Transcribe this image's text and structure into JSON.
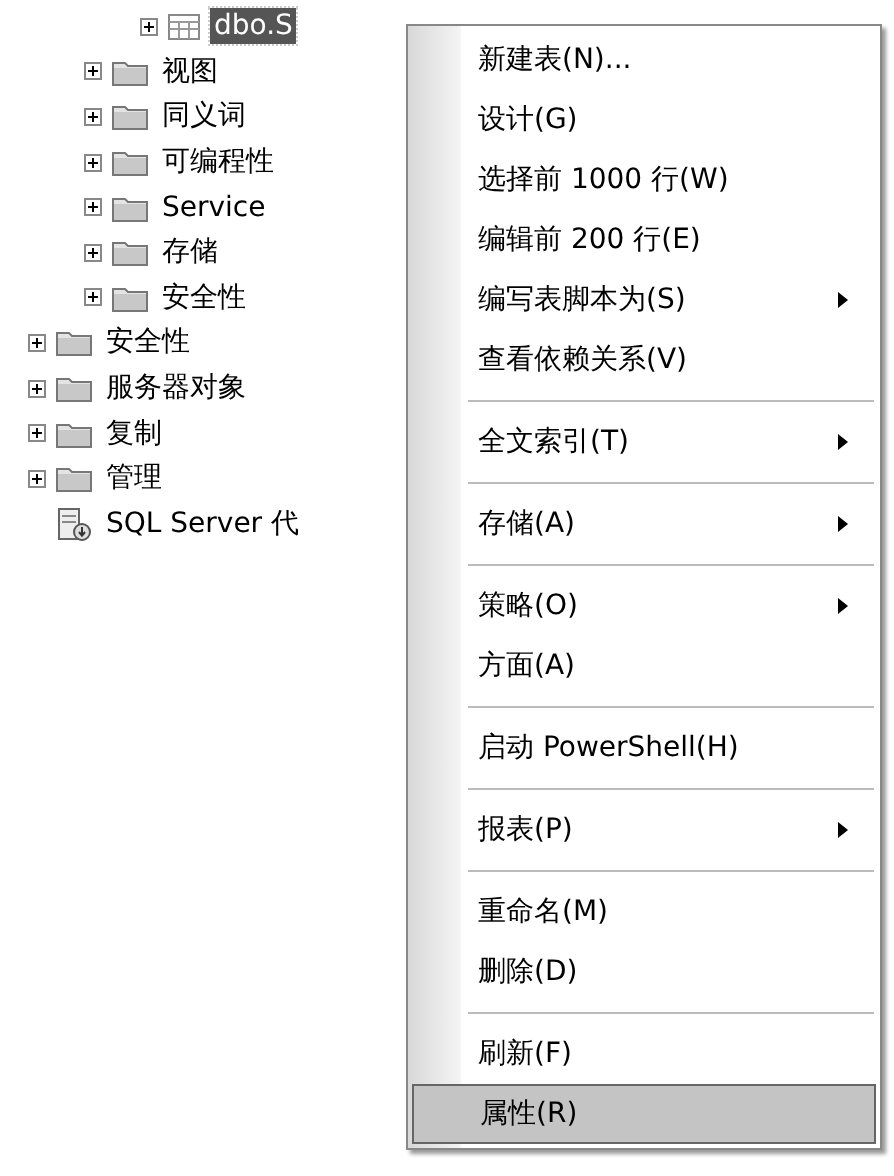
{
  "tree": {
    "children": [
      {
        "children": [
          {
            "children": [
              {
                "label": "dbo.S",
                "kind": "table",
                "expandable": true,
                "selected": true
              }
            ]
          },
          {
            "label": "视图",
            "kind": "folder",
            "expandable": true,
            "selected": false
          },
          {
            "label": "同义词",
            "kind": "folder",
            "expandable": true,
            "selected": false
          },
          {
            "label": "可编程性",
            "kind": "folder",
            "expandable": true,
            "selected": false
          },
          {
            "label": "Service",
            "kind": "folder",
            "expandable": true,
            "selected": false
          },
          {
            "label": "存储",
            "kind": "folder",
            "expandable": true,
            "selected": false
          },
          {
            "label": "安全性",
            "kind": "folder",
            "expandable": true,
            "selected": false
          }
        ]
      },
      {
        "label": "安全性",
        "kind": "folder",
        "expandable": true,
        "selected": false
      },
      {
        "label": "服务器对象",
        "kind": "folder",
        "expandable": true,
        "selected": false
      },
      {
        "label": "复制",
        "kind": "folder",
        "expandable": true,
        "selected": false
      },
      {
        "label": "管理",
        "kind": "folder",
        "expandable": true,
        "selected": false
      },
      {
        "label": "SQL Server 代",
        "kind": "agent",
        "expandable": false,
        "selected": false
      }
    ]
  },
  "context_menu": {
    "items": [
      {
        "kind": "item",
        "label": "新建表(N)...",
        "submenu": false,
        "selected": false
      },
      {
        "kind": "item",
        "label": "设计(G)",
        "submenu": false,
        "selected": false
      },
      {
        "kind": "item",
        "label": "选择前 1000 行(W)",
        "submenu": false,
        "selected": false
      },
      {
        "kind": "item",
        "label": "编辑前 200 行(E)",
        "submenu": false,
        "selected": false
      },
      {
        "kind": "item",
        "label": "编写表脚本为(S)",
        "submenu": true,
        "selected": false
      },
      {
        "kind": "item",
        "label": "查看依赖关系(V)",
        "submenu": false,
        "selected": false
      },
      {
        "kind": "separator"
      },
      {
        "kind": "item",
        "label": "全文索引(T)",
        "submenu": true,
        "selected": false
      },
      {
        "kind": "separator"
      },
      {
        "kind": "item",
        "label": "存储(A)",
        "submenu": true,
        "selected": false
      },
      {
        "kind": "separator"
      },
      {
        "kind": "item",
        "label": "策略(O)",
        "submenu": true,
        "selected": false
      },
      {
        "kind": "item",
        "label": "方面(A)",
        "submenu": false,
        "selected": false
      },
      {
        "kind": "separator"
      },
      {
        "kind": "item",
        "label": "启动 PowerShell(H)",
        "submenu": false,
        "selected": false
      },
      {
        "kind": "separator"
      },
      {
        "kind": "item",
        "label": "报表(P)",
        "submenu": true,
        "selected": false
      },
      {
        "kind": "separator"
      },
      {
        "kind": "item",
        "label": "重命名(M)",
        "submenu": false,
        "selected": false
      },
      {
        "kind": "item",
        "label": "删除(D)",
        "submenu": false,
        "selected": false
      },
      {
        "kind": "separator"
      },
      {
        "kind": "item",
        "label": "刷新(F)",
        "submenu": false,
        "selected": false
      },
      {
        "kind": "item",
        "label": "属性(R)",
        "submenu": false,
        "selected": true
      }
    ]
  }
}
